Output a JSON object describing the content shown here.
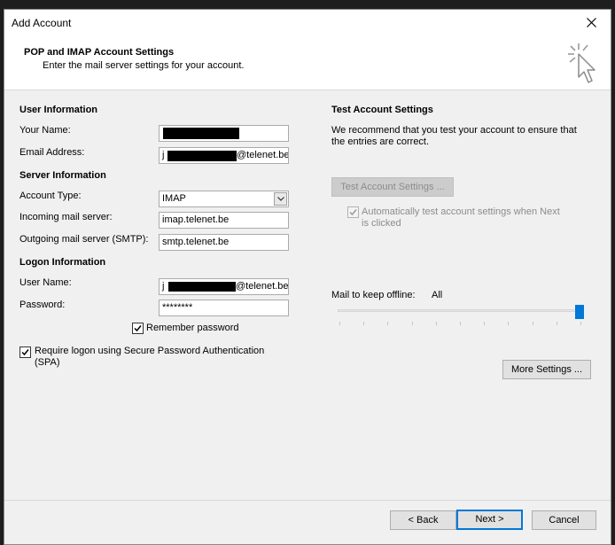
{
  "window": {
    "title": "Add Account"
  },
  "header": {
    "title": "POP and IMAP Account Settings",
    "subtitle": "Enter the mail server settings for your account.",
    "icon": "cursor-sparkle-icon"
  },
  "user_info": {
    "heading": "User Information",
    "name_label": "Your Name:",
    "email_label": "Email Address:",
    "email_visible_prefix": "j",
    "email_visible_suffix": "@telenet.be"
  },
  "server_info": {
    "heading": "Server Information",
    "account_type_label": "Account Type:",
    "account_type_value": "IMAP",
    "incoming_label": "Incoming mail server:",
    "incoming_value": "imap.telenet.be",
    "outgoing_label": "Outgoing mail server (SMTP):",
    "outgoing_value": "smtp.telenet.be"
  },
  "logon_info": {
    "heading": "Logon Information",
    "username_label": "User Name:",
    "username_visible_prefix": "j",
    "username_visible_suffix": "@telenet.be",
    "password_label": "Password:",
    "password_value": "********",
    "remember_label": "Remember password",
    "remember_checked": true,
    "spa_label_line1": "Require logon using Secure Password Authentication",
    "spa_label_line2": "(SPA)",
    "spa_checked": true
  },
  "test_settings": {
    "heading": "Test Account Settings",
    "desc_line1": "We recommend that you test your account to ensure that",
    "desc_line2": "the entries are correct.",
    "test_button": "Test Account Settings ...",
    "auto_test_line1": "Automatically test account settings when Next",
    "auto_test_line2": "is clicked",
    "auto_test_checked": true,
    "mail_offline_label": "Mail to keep offline:",
    "mail_offline_value": "All",
    "mail_offline_level": 1.0,
    "more_settings_button": "More Settings ..."
  },
  "footer": {
    "back_button": "< Back",
    "next_button": "Next >",
    "cancel_button": "Cancel"
  },
  "colors": {
    "accent": "#0078d7",
    "dialog_bg": "#f0f0f0",
    "disabled_text": "#8c8c8c"
  }
}
